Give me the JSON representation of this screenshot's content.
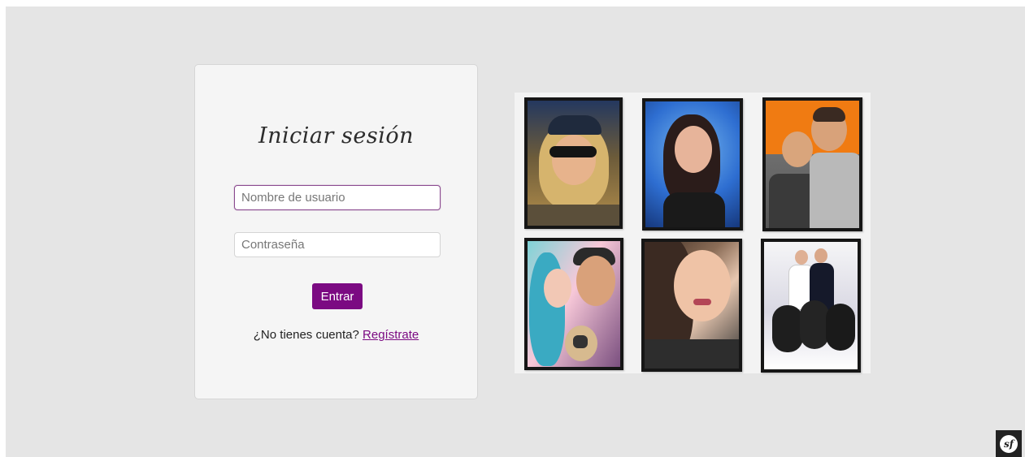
{
  "login": {
    "title": "Iniciar sesión",
    "username_placeholder": "Nombre de usuario",
    "password_placeholder": "Contraseña",
    "submit_label": "Entrar",
    "signup_prompt": "¿No tienes cuenta?",
    "signup_link": "Regístrate"
  },
  "gallery": {
    "images": [
      "woman-cap-sunglasses",
      "woman-smiling-blue-background",
      "two-boys-orange-background",
      "couple-with-pug",
      "woman-selfie-long-hair",
      "couple-with-black-dogs"
    ]
  },
  "toolbar": {
    "logo_text": "sf"
  },
  "colors": {
    "accent": "#7b0a82",
    "page_background": "#e5e5e5",
    "card_background": "#f5f5f5"
  }
}
